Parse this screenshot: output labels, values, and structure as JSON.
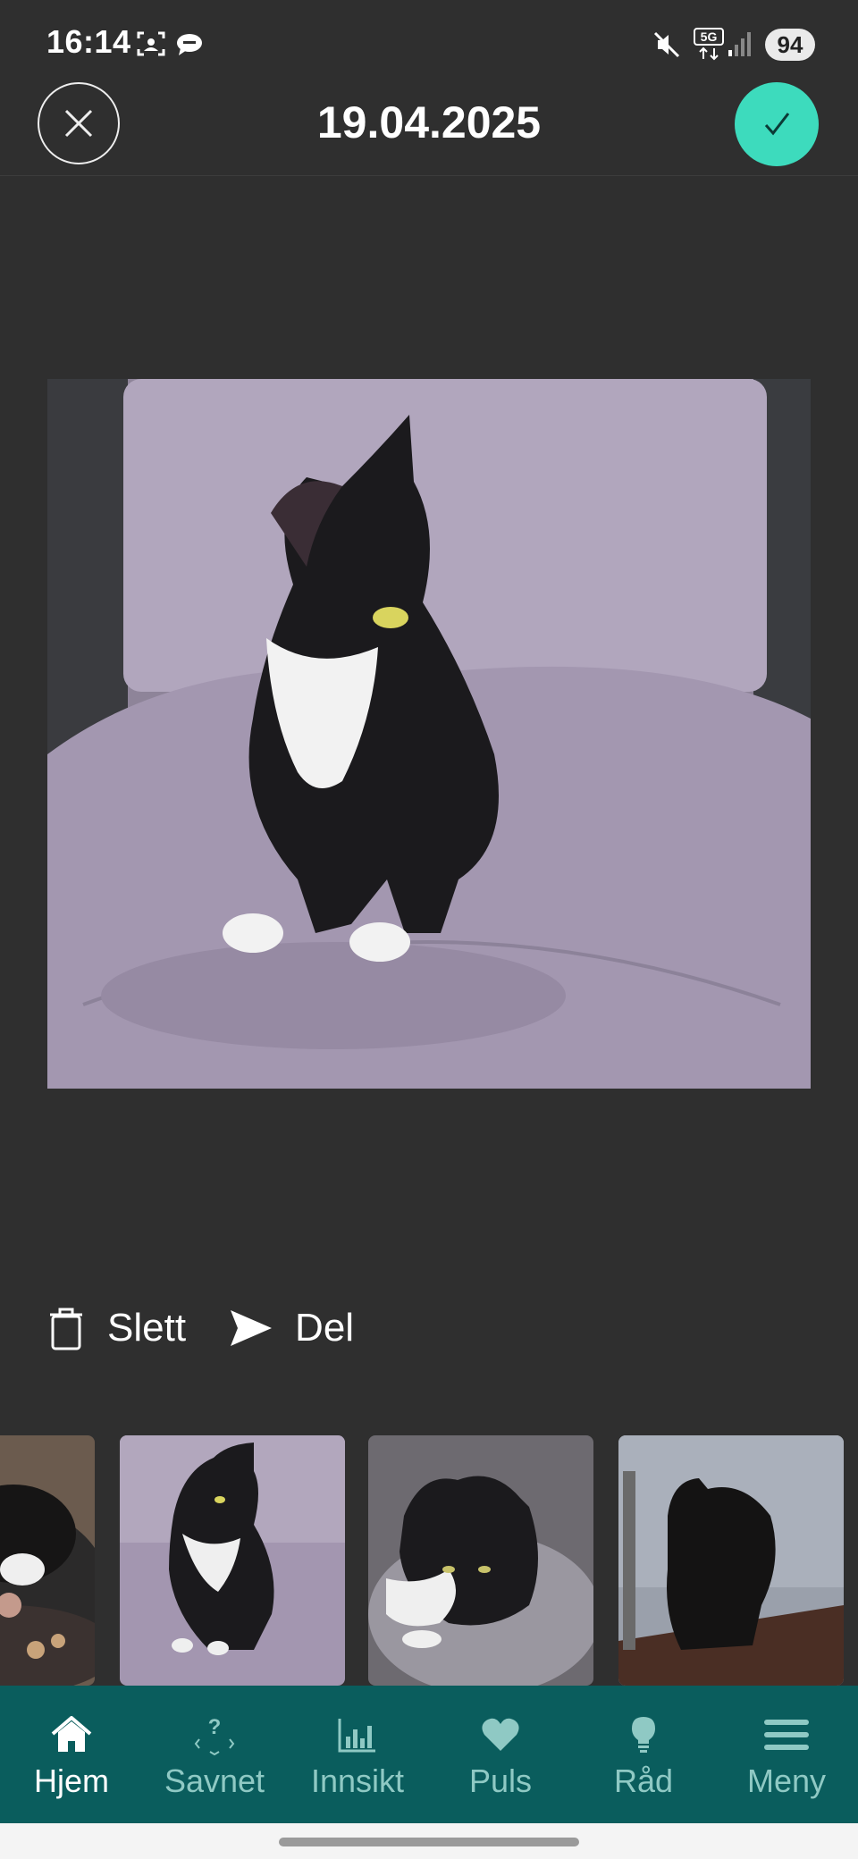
{
  "status_bar": {
    "time": "16:14",
    "battery": "94",
    "network": "5G"
  },
  "header": {
    "title": "19.04.2025",
    "close_icon": "close-icon",
    "confirm_icon": "checkmark-icon",
    "confirm_color": "#3ddbbd"
  },
  "photo": {
    "subject": "black and white cat sitting on lavender cushion"
  },
  "actions": {
    "delete_label": "Slett",
    "share_label": "Del"
  },
  "thumbnails": [
    {
      "name": "thumb-1"
    },
    {
      "name": "thumb-2",
      "selected": true
    },
    {
      "name": "thumb-3"
    },
    {
      "name": "thumb-4"
    }
  ],
  "tabs": [
    {
      "label": "Hjem",
      "icon": "home-icon",
      "active": true
    },
    {
      "label": "Savnet",
      "icon": "missing-icon"
    },
    {
      "label": "Innsikt",
      "icon": "chart-icon"
    },
    {
      "label": "Puls",
      "icon": "heart-icon"
    },
    {
      "label": "Råd",
      "icon": "lightbulb-icon"
    },
    {
      "label": "Meny",
      "icon": "menu-icon"
    }
  ],
  "colors": {
    "background": "#2f2f2f",
    "tabbar": "#0a5d5d",
    "tab_inactive": "#8fc9c4",
    "accent": "#3ddbbd"
  }
}
